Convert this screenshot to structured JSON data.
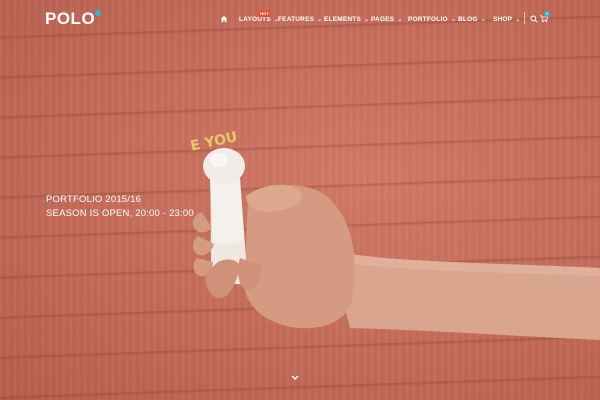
{
  "header": {
    "logo": "POLO",
    "nav": [
      {
        "label": "LAYOUTS",
        "badge": "HOT",
        "has_dropdown": true
      },
      {
        "label": "FEATURES",
        "has_dropdown": true
      },
      {
        "label": "ELEMENTS",
        "has_dropdown": true
      },
      {
        "label": "PAGES",
        "has_dropdown": true
      },
      {
        "label": "PORTFOLIO",
        "has_dropdown": true
      },
      {
        "label": "BLOG",
        "has_dropdown": true
      },
      {
        "label": "SHOP",
        "has_dropdown": true
      }
    ],
    "icons": {
      "home": "home-icon",
      "search": "search-icon",
      "cart": "cart-icon"
    },
    "cart_count": "0"
  },
  "hero": {
    "line1": "PORTFOLIO 2015/16",
    "line2": "SEASON IS OPEN, 20:00 - 23:00",
    "fan_text": "E YOU"
  },
  "colors": {
    "background": "#c9705f",
    "accent": "#2fb6c8",
    "badge": "#e0533d",
    "led_text": "#e8d36a"
  }
}
